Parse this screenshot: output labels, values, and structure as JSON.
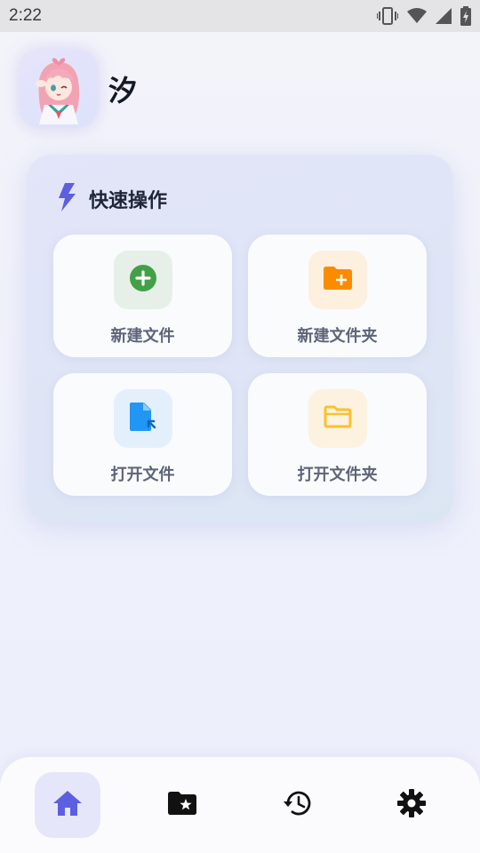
{
  "status_bar": {
    "time": "2:22",
    "icons": [
      "vibrate-icon",
      "wifi-icon",
      "signal-icon",
      "battery-charging-icon"
    ]
  },
  "profile": {
    "name": "汐",
    "avatar_icon": "anime-character-avatar"
  },
  "quick_actions": {
    "title": "快速操作",
    "title_icon": "lightning-bolt-icon",
    "items": [
      {
        "label": "新建文件",
        "icon": "plus-circle-icon",
        "color": "#43a047"
      },
      {
        "label": "新建文件夹",
        "icon": "folder-plus-icon",
        "color": "#fb8c00"
      },
      {
        "label": "打开文件",
        "icon": "file-open-icon",
        "color": "#2196f3"
      },
      {
        "label": "打开文件夹",
        "icon": "folder-outline-icon",
        "color": "#fbc02d"
      }
    ]
  },
  "bottom_nav": {
    "items": [
      {
        "icon": "home-icon",
        "active": true
      },
      {
        "icon": "folder-star-icon",
        "active": false
      },
      {
        "icon": "history-icon",
        "active": false
      },
      {
        "icon": "settings-icon",
        "active": false
      }
    ]
  },
  "colors": {
    "accent": "#5c5fe0",
    "active_nav_bg": "#e6e6fa"
  }
}
